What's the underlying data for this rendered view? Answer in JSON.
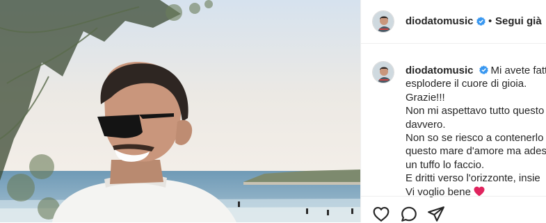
{
  "post": {
    "username": "diodatomusic",
    "separator": "•",
    "follow_label": "Segui già",
    "caption_lines": [
      "Mi avete fatt",
      "esplodere il cuore di gioia.",
      "Grazie!!!",
      "Non mi aspettavo tutto questo",
      "davvero.",
      "Non so se riesco a contenerlo",
      "questo mare d'amore ma ades",
      "un tuffo lo faccio.",
      "E dritti verso l'orizzonte, insie",
      "Vi voglio bene"
    ],
    "caption_emoji": "❤️"
  },
  "icons": {
    "verified": "verified-badge-icon",
    "like": "heart-icon",
    "comment": "comment-bubble-icon",
    "share": "paper-plane-icon"
  },
  "colors": {
    "verified_blue": "#3897f0",
    "text": "#262626",
    "heart_red": "#ed4956",
    "divider": "#efefef"
  }
}
